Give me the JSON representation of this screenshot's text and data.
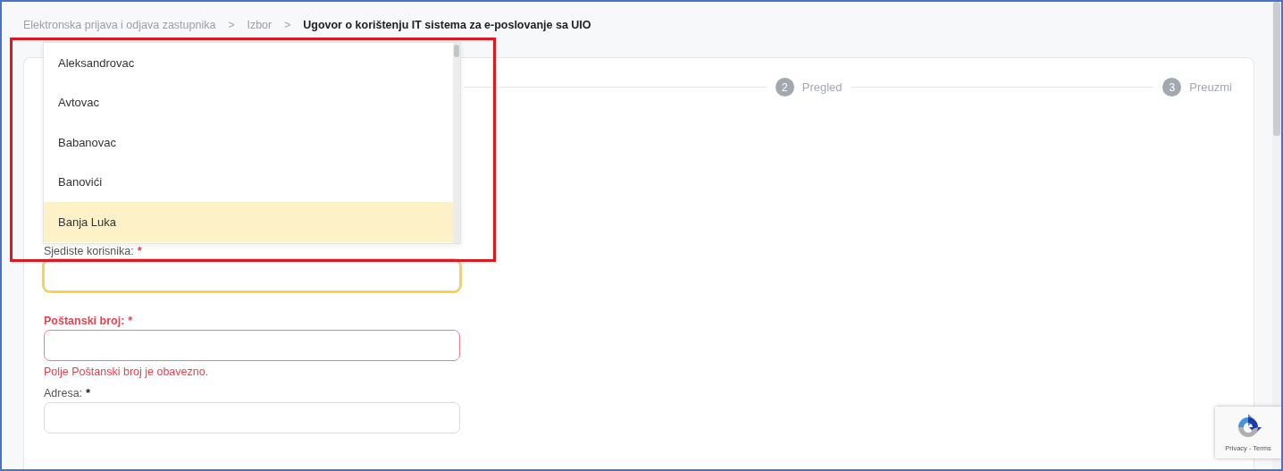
{
  "breadcrumb": [
    {
      "label": "Elektronska prijava i odjava zastupnika",
      "current": false
    },
    {
      "label": "Izbor",
      "current": false
    },
    {
      "label": "Ugovor o korištenju IT sistema za e-poslovanje sa UIO",
      "current": true
    }
  ],
  "breadcrumb_separator": ">",
  "stepper": [
    {
      "number": "2",
      "label": "Pregled"
    },
    {
      "number": "3",
      "label": "Preuzmi"
    }
  ],
  "dropdown": {
    "options": [
      {
        "label": "Aleksandrovac",
        "selected": false
      },
      {
        "label": "Avtovac",
        "selected": false
      },
      {
        "label": "Babanovac",
        "selected": false
      },
      {
        "label": "Banovići",
        "selected": false
      },
      {
        "label": "Banja Luka",
        "selected": true
      }
    ]
  },
  "fields": [
    {
      "label": "Sjediste korisnika:",
      "required_mark": "*",
      "focused": true,
      "invalid": false
    },
    {
      "label": "Poštanski broj:",
      "required_mark": "*",
      "focused": false,
      "invalid": true,
      "error": "Polje Poštanski broj je obavezno."
    },
    {
      "label": "Adresa:",
      "required_mark": "*",
      "focused": false,
      "invalid": false
    }
  ],
  "recaptcha": {
    "links": "Privacy - Terms"
  }
}
